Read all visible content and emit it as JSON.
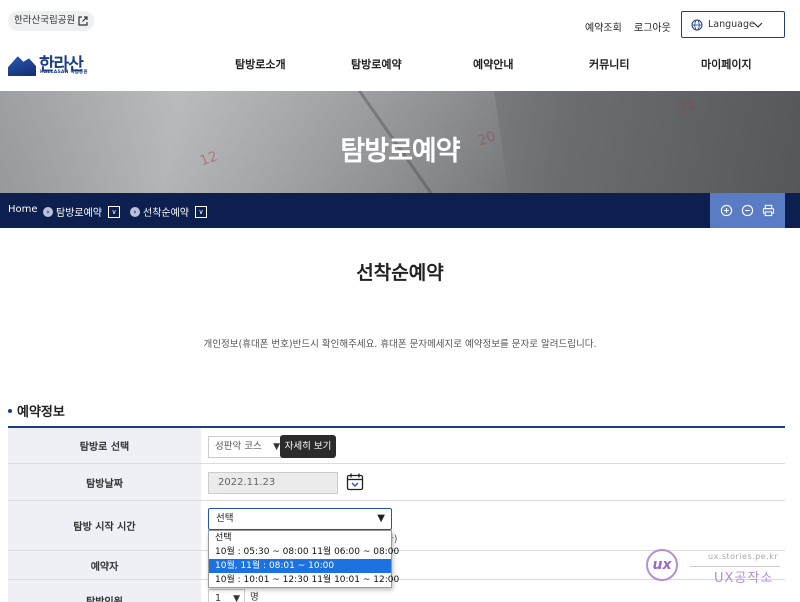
{
  "header": {
    "site_link": "한라산국립공원",
    "util_links": [
      "예약조회",
      "로그아웃"
    ],
    "language_label": "Language",
    "logo": {
      "korean": "한라산",
      "english": "HALLASAN 국립공원"
    },
    "gnb": [
      "탐방로소개",
      "탐방로예약",
      "예약안내",
      "커뮤니티",
      "마이페이지"
    ]
  },
  "banner": {
    "title": "탐방로예약",
    "calendar_numbers": [
      "20",
      "21",
      "12"
    ]
  },
  "breadcrumb": {
    "items": [
      "Home",
      "탐방로예약",
      "선착순예약"
    ],
    "tools": [
      "zoom-in-icon",
      "zoom-out-icon",
      "print-icon"
    ]
  },
  "page": {
    "title": "선착순예약",
    "notice": "개인정보(휴대폰 번호)반드시 확인해주세요. 휴대폰 문자메세지로 예약정보를 문자로 알려드립니다."
  },
  "section": {
    "title": "예약정보"
  },
  "form": {
    "trail": {
      "label": "탐방로 선택",
      "value": "성판악 코스",
      "detail_button": "자세히 보기"
    },
    "date": {
      "label": "탐방날짜",
      "value": "2022.11.23"
    },
    "start_time": {
      "label": "탐방 시작 시간",
      "value": "선택",
      "hint_tail": "다)",
      "options": [
        "선택",
        "10월 : 05:30 ~ 08:00 11월 06:00 ~ 08:00",
        "10월, 11월 : 08:01 ~ 10:00",
        "10월 : 10:01 ~ 12:30 11월 10:01 ~ 12:00"
      ],
      "highlighted_index": 2
    },
    "reserver": {
      "label": "예약자"
    },
    "headcount": {
      "label": "탐방인원",
      "value": "1",
      "unit": "명"
    }
  },
  "watermark": {
    "url": "ux.stories.pe.kr",
    "brand": "UX공작소",
    "logo_letters": "ux"
  },
  "colors": {
    "navy": "#0d1f4f",
    "accent": "#1d3f86",
    "tool_bg": "#5a7cc4",
    "selected_option": "#1c72e0"
  }
}
